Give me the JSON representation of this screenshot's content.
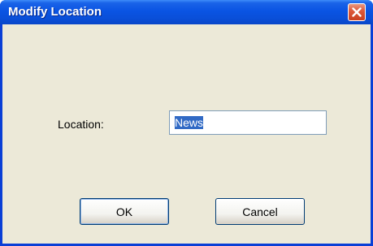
{
  "window": {
    "title": "Modify Location"
  },
  "form": {
    "location_label": "Location:",
    "location_value": "News"
  },
  "buttons": {
    "ok_label": "OK",
    "cancel_label": "Cancel"
  },
  "icons": {
    "close": "close-icon"
  },
  "colors": {
    "titlebar": "#0a54e3",
    "client_bg": "#ece9d8",
    "close_button": "#dd5a3b",
    "selection": "#316ac5"
  }
}
